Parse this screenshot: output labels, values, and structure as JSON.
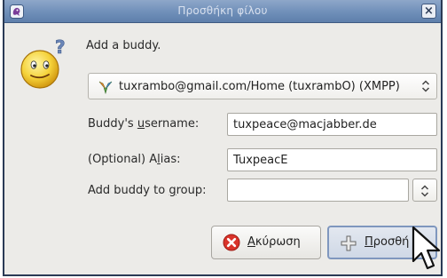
{
  "window": {
    "title": "Προσθήκη φίλου",
    "close_label": "×"
  },
  "dialog": {
    "intro": "Add a buddy.",
    "account": {
      "value": "tuxrambo@gmail.com/Home (tuxrambO) (XMPP)",
      "icon": "xmpp-protocol-icon"
    },
    "username": {
      "label_before": "Buddy's ",
      "label_mnemonic": "u",
      "label_after": "sername:",
      "value": "tuxpeace@macjabber.de"
    },
    "alias": {
      "label_before": "(Optional) A",
      "label_mnemonic": "l",
      "label_after": "ias:",
      "value": "TuxpeacE"
    },
    "group": {
      "label_before": "Add buddy to ",
      "label_mnemonic": "g",
      "label_after": "roup:",
      "value": ""
    }
  },
  "buttons": {
    "cancel": {
      "mnemonic": "Α",
      "rest": "κύρωση",
      "icon": "cancel-icon"
    },
    "add": {
      "mnemonic": "Π",
      "rest": "ροσθή",
      "icon": "add-icon"
    }
  },
  "colors": {
    "titlebar": "#6f8fb9",
    "window_bg": "#ecebe8",
    "cancel_red": "#d9342b",
    "default_button_border": "#7f97be"
  }
}
